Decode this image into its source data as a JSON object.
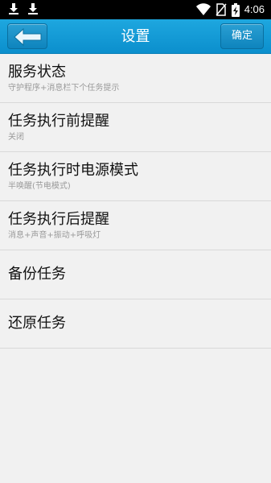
{
  "status_bar": {
    "left_icons": [
      "download-icon",
      "download-icon"
    ],
    "right_icons": [
      "wifi-icon",
      "no-sim-icon",
      "battery-charging-icon"
    ],
    "time": "4:06"
  },
  "app_bar": {
    "title": "设置",
    "confirm_label": "确定",
    "accent_color": "#1a9fd9"
  },
  "settings": {
    "items": [
      {
        "title": "服务状态",
        "subtitle": "守护程序+消息栏下个任务提示"
      },
      {
        "title": "任务执行前提醒",
        "subtitle": "关闭"
      },
      {
        "title": "任务执行时电源模式",
        "subtitle": "半唤醒(节电模式)"
      },
      {
        "title": "任务执行后提醒",
        "subtitle": "消息+声音+振动+呼吸灯"
      },
      {
        "title": "备份任务"
      },
      {
        "title": "还原任务"
      }
    ]
  }
}
